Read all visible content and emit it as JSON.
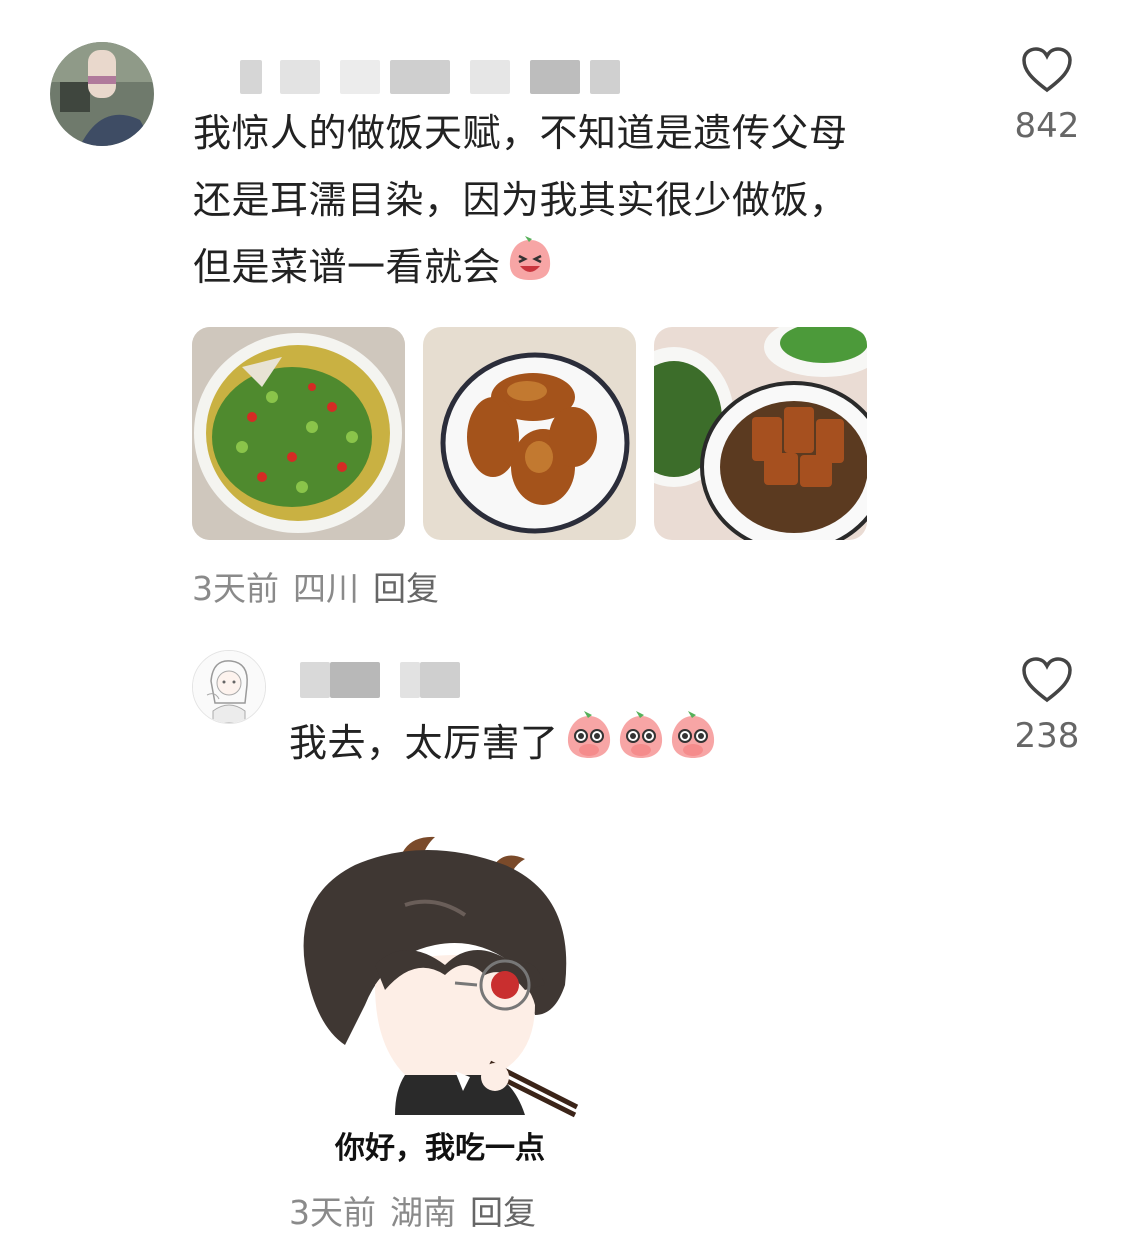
{
  "comments": [
    {
      "avatar_icon": "user-avatar-photo",
      "text_lines": [
        "我惊人的做饭天赋，不知道是遗传父母",
        "还是耳濡目染，因为我其实很少做饭，",
        "但是菜谱一看就会"
      ],
      "emoji": "laughing-peach-emoji",
      "likes": "842",
      "images": [
        "sichuan-fish-dish",
        "roast-chicken-wings",
        "braised-pork-dishes"
      ],
      "time": "3天前",
      "location": "四川",
      "reply_label": "回复"
    },
    {
      "avatar_icon": "anime-girl-avatar",
      "text": "我去，太厉害了",
      "emoji": "shocked-peach-emoji",
      "likes": "238",
      "sticker_caption": "你好，我吃一点",
      "time": "3天前",
      "location": "湖南",
      "reply_label": "回复"
    }
  ]
}
